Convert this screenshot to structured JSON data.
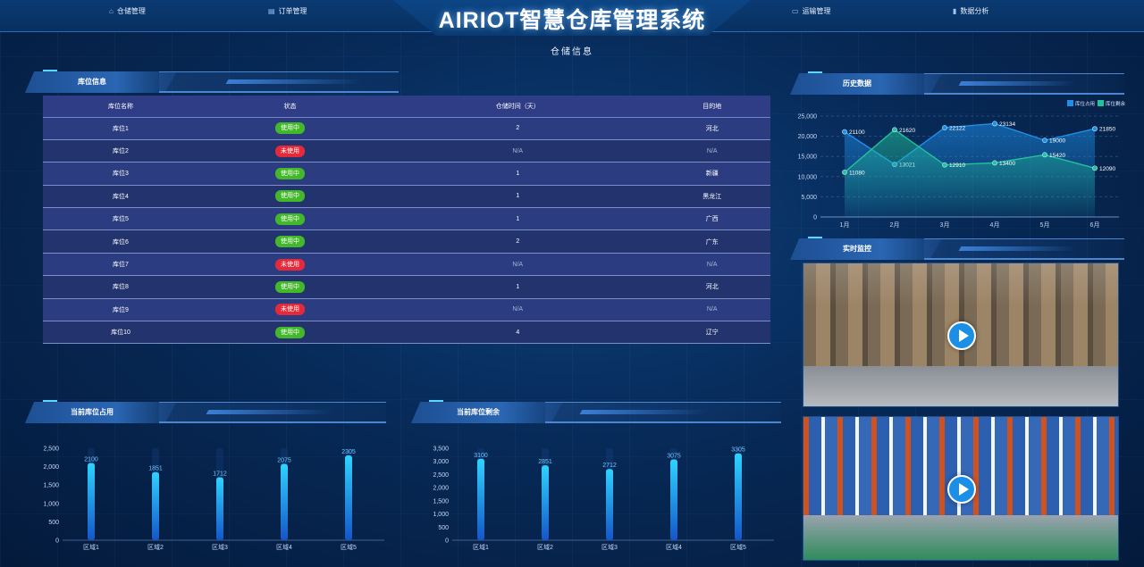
{
  "header": {
    "title": "AIRIOT智慧仓库管理系统",
    "nav_left": [
      {
        "label": "仓储管理",
        "icon": "home-icon"
      },
      {
        "label": "订单管理",
        "icon": "clipboard-icon"
      }
    ],
    "nav_right": [
      {
        "label": "运输管理",
        "icon": "truck-icon"
      },
      {
        "label": "数据分析",
        "icon": "bar-chart-icon"
      }
    ],
    "subtitle": "仓储信息"
  },
  "sections": {
    "storage_info": "库位信息",
    "history": "历史数据",
    "monitor": "实时监控",
    "occupancy": "当前库位占用",
    "remaining": "当前库位剩余"
  },
  "table": {
    "columns": [
      "库位名称",
      "状态",
      "仓储时间（天）",
      "目的地"
    ],
    "rows": [
      {
        "name": "库位1",
        "status": "使用中",
        "in_use": true,
        "days": "2",
        "dest": "河北"
      },
      {
        "name": "库位2",
        "status": "未使用",
        "in_use": false,
        "days": "N/A",
        "dest": "N/A"
      },
      {
        "name": "库位3",
        "status": "使用中",
        "in_use": true,
        "days": "1",
        "dest": "新疆"
      },
      {
        "name": "库位4",
        "status": "使用中",
        "in_use": true,
        "days": "1",
        "dest": "黑龙江"
      },
      {
        "name": "库位5",
        "status": "使用中",
        "in_use": true,
        "days": "1",
        "dest": "广西"
      },
      {
        "name": "库位6",
        "status": "使用中",
        "in_use": true,
        "days": "2",
        "dest": "广东"
      },
      {
        "name": "库位7",
        "status": "未使用",
        "in_use": false,
        "days": "N/A",
        "dest": "N/A"
      },
      {
        "name": "库位8",
        "status": "使用中",
        "in_use": true,
        "days": "1",
        "dest": "河北"
      },
      {
        "name": "库位9",
        "status": "未使用",
        "in_use": false,
        "days": "N/A",
        "dest": "N/A"
      },
      {
        "name": "库位10",
        "status": "使用中",
        "in_use": true,
        "days": "4",
        "dest": "辽宁"
      }
    ]
  },
  "colors": {
    "in_use": "#43b82a",
    "unused": "#e42a3a",
    "series_occupied": "#1e8fe8",
    "series_remaining": "#22c39a"
  },
  "chart_data": [
    {
      "type": "area",
      "categories": [
        "1月",
        "2月",
        "3月",
        "4月",
        "5月",
        "6月"
      ],
      "series": [
        {
          "name": "库位占用",
          "values": [
            21100,
            13021,
            22122,
            23134,
            19000,
            21850
          ]
        },
        {
          "name": "库位剩余",
          "values": [
            11080,
            21620,
            12910,
            13400,
            15420,
            12090
          ]
        }
      ],
      "yticks": [
        "0",
        "5,000",
        "10,000",
        "15,000",
        "20,000",
        "25,000"
      ],
      "ylim": [
        0,
        25000
      ],
      "legend": "top-right",
      "grid": true
    },
    {
      "type": "bar",
      "categories": [
        "区域1",
        "区域2",
        "区域3",
        "区域4",
        "区域5"
      ],
      "values": [
        2100,
        1851,
        1712,
        2075,
        2305
      ],
      "yticks": [
        "0",
        "500",
        "1,000",
        "1,500",
        "2,000",
        "2,500"
      ],
      "ylim": [
        0,
        2500
      ]
    },
    {
      "type": "bar",
      "categories": [
        "区域1",
        "区域2",
        "区域3",
        "区域4",
        "区域5"
      ],
      "values": [
        3100,
        2851,
        2712,
        3075,
        3305
      ],
      "yticks": [
        "0",
        "500",
        "1,000",
        "1,500",
        "2,000",
        "2,500",
        "3,000",
        "3,500"
      ],
      "ylim": [
        0,
        3500
      ]
    }
  ]
}
